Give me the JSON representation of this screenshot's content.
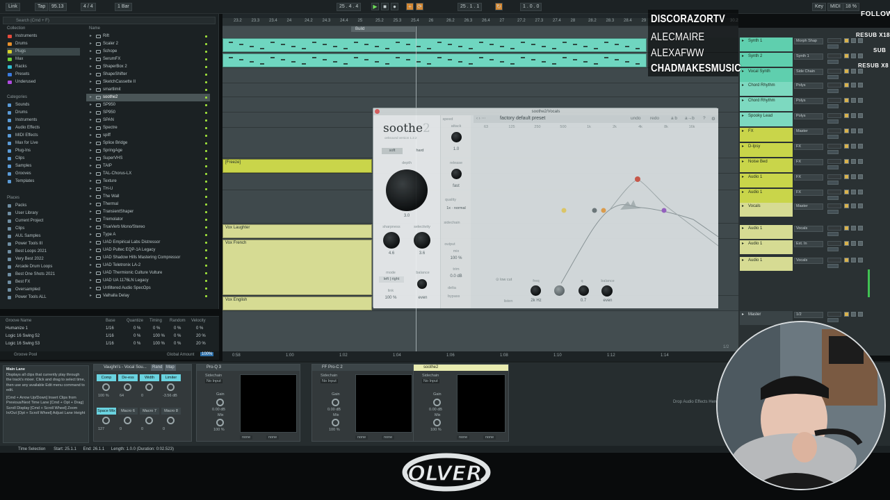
{
  "transport": {
    "link": "Link",
    "tap": "Tap",
    "tempo": "95.13",
    "sig": "4 / 4",
    "bar_mode": "1 Bar",
    "position": "25 . 4 . 4",
    "loop_start": "25 . 1 . 1",
    "loop_len": "1 . 0 . 0",
    "key": "Key",
    "midi": "MIDI",
    "cpu": "18 %"
  },
  "browser": {
    "search_placeholder": "Search (Cmd + F)",
    "collections_header": "Collection",
    "name_header": "Name",
    "collections": [
      {
        "label": "Instruments",
        "color": "#e64b3c"
      },
      {
        "label": "Drums",
        "color": "#e8902b"
      },
      {
        "label": "Plugs",
        "color": "#d9d229"
      },
      {
        "label": "Max",
        "color": "#6dcf3a"
      },
      {
        "label": "Racks",
        "color": "#2fc0d2"
      },
      {
        "label": "Presets",
        "color": "#3a7be0"
      },
      {
        "label": "Underused",
        "color": "#b04be0"
      }
    ],
    "categories_header": "Categories",
    "categories": [
      "Sounds",
      "Drums",
      "Instruments",
      "Audio Effects",
      "MIDI Effects",
      "Max for Live",
      "Plug-Ins",
      "Clips",
      "Samples",
      "Grooves",
      "Templates"
    ],
    "places_header": "Places",
    "places": [
      "Packs",
      "User Library",
      "Current Project",
      "Clips",
      "AUL Samples",
      "Power Tools III",
      "Best Loops 2021",
      "Very Best 2022",
      "Arcade Drum Loops",
      "Best One Shots 2021",
      "Best FX",
      "Oversampled",
      "Power Tools ALL"
    ],
    "files": [
      "Rift",
      "Scaler 2",
      "Schope",
      "SerumFX",
      "ShaperBox 2",
      "ShapeShifter",
      "SketchCassette II",
      "smartlimit",
      "soothe2",
      "SP950",
      "SP950",
      "SPAN",
      "Spectre",
      "spiff",
      "Splice Bridge",
      "SpringAge",
      "SuperVHS",
      "TAIP",
      "TAL-Chorus-LX",
      "Texture",
      "TH-U",
      "The Wall",
      "Thermal",
      "TransientShaper",
      "Tremolator",
      "TrueVerb Mono/Stereo",
      "Type A",
      "UAD Empirical Labs Distressor",
      "UAD Pultec EQP-1A Legacy",
      "UAD Shadow Hills Mastering Compressor",
      "UAD Teletronix LA-2",
      "UAD Thermionic Culture Vulture",
      "UAD UA 1176LN Legacy",
      "Unfiltered Audio SpecOps",
      "Valhalla Delay"
    ]
  },
  "groove": {
    "headers": [
      "Groove Name",
      "Base",
      "Quantize",
      "Timing",
      "Random",
      "Velocity"
    ],
    "rows": [
      {
        "name": "Humanize 1",
        "base": "1/16",
        "q": "0 %",
        "t": "0 %",
        "r": "0 %",
        "v": "0 %"
      },
      {
        "name": "Logic 16 Swing 52",
        "base": "1/16",
        "q": "0 %",
        "t": "100 %",
        "r": "0 %",
        "v": "20 %"
      },
      {
        "name": "Logic 16 Swing 53",
        "base": "1/16",
        "q": "0 %",
        "t": "100 %",
        "r": "0 %",
        "v": "20 %"
      }
    ],
    "footer": "Groove Pool",
    "global_label": "Global Amount",
    "global_value": "100%"
  },
  "arrangement": {
    "ruler": [
      "23.2",
      "23.3",
      "23.4",
      "24",
      "24.2",
      "24.3",
      "24.4",
      "25",
      "25.2",
      "25.3",
      "25.4",
      "26",
      "26.2",
      "26.3",
      "26.4",
      "27",
      "27.2",
      "27.3",
      "27.4",
      "28",
      "28.2",
      "28.3",
      "28.4",
      "29",
      "29.2",
      "29.3",
      "29.4",
      "30",
      "30.2"
    ],
    "loop_label": "Build",
    "clips": {
      "freeze": "[Freeze]",
      "vox_laughter": "Vox Laughter",
      "vox_french": "Vox French",
      "vox_english": "Vox English"
    },
    "time": [
      "0:58",
      "1:00",
      "1:02",
      "1:04",
      "1:06",
      "1:08",
      "1:10",
      "1:12",
      "1:14"
    ],
    "zoom": "1/2"
  },
  "tracks": [
    {
      "name": "Synth 1",
      "color": "#5fcfae",
      "io": "Morph Shap"
    },
    {
      "name": "Synth 2",
      "color": "#5fcfae",
      "io": "Synth 1"
    },
    {
      "name": "Vocal Synth",
      "color": "#5fcfae",
      "io": "Side Chain"
    },
    {
      "name": "Chord Rhythm",
      "color": "#7dd9c0",
      "io": "Polys"
    },
    {
      "name": "Chord Rhythm",
      "color": "#7dd9c0",
      "io": "Polys"
    },
    {
      "name": "Spooky Lead",
      "color": "#7dd9c0",
      "io": "Polys"
    },
    {
      "name": "FX",
      "color": "#c9d54a",
      "io": "Master"
    },
    {
      "name": "D-Ipsy",
      "color": "#c9d54a",
      "io": "FX"
    },
    {
      "name": "Noise Bed",
      "color": "#c9d54a",
      "io": "FX"
    },
    {
      "name": "Audio 1",
      "color": "#c9d54a",
      "io": "FX"
    },
    {
      "name": "Audio 1",
      "color": "#c9d54a",
      "io": "FX"
    },
    {
      "name": "Vocals",
      "color": "#d6db93",
      "io": "Master"
    },
    {
      "name": "Audio 1",
      "color": "#d6db93",
      "io": "Vocals"
    },
    {
      "name": "Audio 1",
      "color": "#d6db93",
      "io": "Ext. In"
    },
    {
      "name": "Audio 1",
      "color": "#d6db93",
      "io": "Vocals"
    },
    {
      "name": "Master",
      "color": "#3a4346",
      "io": "1/2"
    }
  ],
  "overlay": {
    "follow": "FOLLOW",
    "resub_x18": "RESUB X18",
    "sub": "SUB",
    "resub_x8": "RESUB X8",
    "names": [
      "DISCORAZORTV",
      "ALECMAIRE",
      "ALEXAFWW",
      "CHADMAKESMUSIC"
    ],
    "logo": "OLVER"
  },
  "plugin": {
    "window_title": "soothe2/Vocals",
    "brand": "soothe",
    "brand_num": "2",
    "brand_sub": "oeksound  version 1.2.2",
    "preset": "factory default preset",
    "undo": "undo",
    "redo": "redo",
    "ab": "a b",
    "a_to_b": "a→b",
    "soft": "soft",
    "hard": "hard",
    "depth_label": "depth",
    "depth_value": "3.0",
    "sharpness_label": "sharpness",
    "sharpness_value": "4.6",
    "selectivity_label": "selectivity",
    "selectivity_value": "3.6",
    "speed_label": "speed",
    "attack_label": "attack",
    "attack_value": "1.0",
    "release_label": "release",
    "release_value": "fast",
    "quality_label": "quality",
    "quality_value": "1x · normal",
    "mode_label": "mode",
    "mode_value": "left | right",
    "balance_label": "balance",
    "balance_value": "even",
    "link_label": "link",
    "link_value": "100 %",
    "sidechain_label": "sidechain",
    "output_label": "output",
    "mix_label": "mix",
    "mix_value": "100 %",
    "trim_label": "trim",
    "trim_value": "0.0 dB",
    "delta_label": "delta",
    "bypass_label": "bypass",
    "freq_axis": [
      "63",
      "125",
      "250",
      "500",
      "1k",
      "2k",
      "4k",
      "8k",
      "16k"
    ],
    "band_type": "low cut",
    "band_freq_label": "freq",
    "band_freq_value": "2k Hz",
    "band_q_label": "q",
    "band_q_value": "0.7",
    "band_balance_label": "balance",
    "band_balance_value": "even",
    "listen_label": "listen"
  },
  "devices": {
    "info_title": "Main Lane",
    "info_text": "Displays all clips that currently play through the track's mixer. Click and drag to select time, then use any available Edit menu command to edit.",
    "info_shortcuts": "[Cmd + Arrow Up/Down] Insert Clips from Previous/Next Time Lane  [Cmd + Opt + Drag] Scroll Display  [Cmd + Scroll Wheel] Zoom In/Out  [Opt + Scroll Wheel] Adjust Lane Height",
    "rack_name": "Vaughn's - Vocal Sou...",
    "rack_rand": "Rand",
    "rack_map": "Map",
    "macros": [
      {
        "label": "Comp",
        "value": "100 %",
        "color": "#6ad3e0"
      },
      {
        "label": "De-ess",
        "value": "64",
        "color": "#6ad3e0"
      },
      {
        "label": "Width",
        "value": "0",
        "color": "#6ad3e0"
      },
      {
        "label": "Limiter",
        "value": "-3.56 dB",
        "color": "#6ad3e0"
      },
      {
        "label": "Space Mix",
        "value": "127",
        "color": "#6ad3e0"
      },
      {
        "label": "Macro 6",
        "value": "0",
        "color": "#3c4548"
      },
      {
        "label": "Macro 7",
        "value": "0",
        "color": "#3c4548"
      },
      {
        "label": "Macro 8",
        "value": "0",
        "color": "#3c4548"
      }
    ],
    "plugins": [
      {
        "name": "Pro-Q 3",
        "sidechain": "Sidechain",
        "input": "No Input",
        "gain_label": "Gain",
        "gain_value": "0.00 dB",
        "mix_label": "Mix",
        "mix_value": "100 %",
        "none1": "none",
        "none2": "none"
      },
      {
        "name": "FF Pro-C 2",
        "sidechain": "Sidechain",
        "input": "No Input",
        "gain_label": "Gain",
        "gain_value": "0.00 dB",
        "mix_label": "Mix",
        "mix_value": "100 %",
        "none1": "none",
        "none2": "none"
      },
      {
        "name": "soothe2",
        "sidechain": "Sidechain",
        "input": "No Input",
        "gain_label": "Gain",
        "gain_value": "0.00 dB",
        "mix_label": "Mix",
        "mix_value": "100 %",
        "none1": "none",
        "none2": "none"
      }
    ],
    "drop_hint": "Drop Audio Effects Here"
  },
  "status": {
    "label": "Time Selection",
    "start": "Start: 25.1.1",
    "end": "End: 26.1.1",
    "length": "Length: 1.0.0 (Duration: 0:02.523)"
  }
}
